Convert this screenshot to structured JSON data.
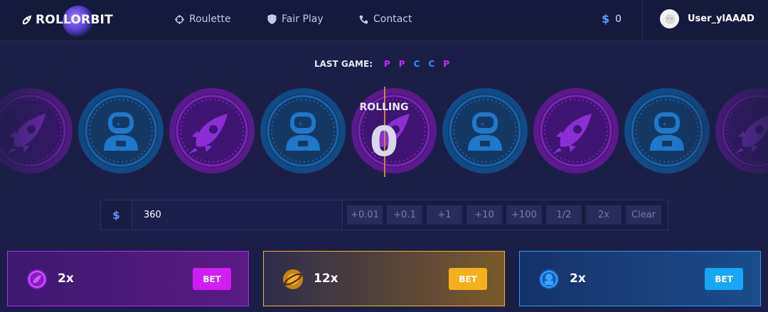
{
  "header": {
    "logo_text": "ROLLORBIT",
    "nav": [
      {
        "label": "Roulette",
        "icon": "crosshair-icon"
      },
      {
        "label": "Fair Play",
        "icon": "shield-icon"
      },
      {
        "label": "Contact",
        "icon": "phone-icon"
      }
    ],
    "balance_symbol": "$",
    "balance": "0",
    "username": "User_ylAAAD"
  },
  "last_game": {
    "label": "LAST GAME:",
    "results": [
      "P",
      "P",
      "C",
      "C",
      "P"
    ]
  },
  "roller": {
    "status": "ROLLING",
    "number": "0",
    "sequence": [
      "rocket",
      "astronaut",
      "rocket",
      "astronaut",
      "rocket",
      "astronaut",
      "rocket",
      "astronaut",
      "rocket"
    ]
  },
  "bet": {
    "currency_symbol": "$",
    "amount": "360",
    "buttons": [
      "+0.01",
      "+0.1",
      "+1",
      "+10",
      "+100",
      "1/2",
      "2x",
      "Clear"
    ]
  },
  "panels": [
    {
      "multiplier": "2x",
      "button": "BET",
      "color": "#d21cf4",
      "icon": "rocket-icon"
    },
    {
      "multiplier": "12x",
      "button": "BET",
      "color": "#f4b01c",
      "icon": "planet-icon"
    },
    {
      "multiplier": "2x",
      "button": "BET",
      "color": "#18a6f6",
      "icon": "astronaut-icon"
    }
  ],
  "colors": {
    "background": "#1b1f47",
    "purple": "#c42bff",
    "blue": "#2e8fff",
    "gold": "#f0b227"
  }
}
